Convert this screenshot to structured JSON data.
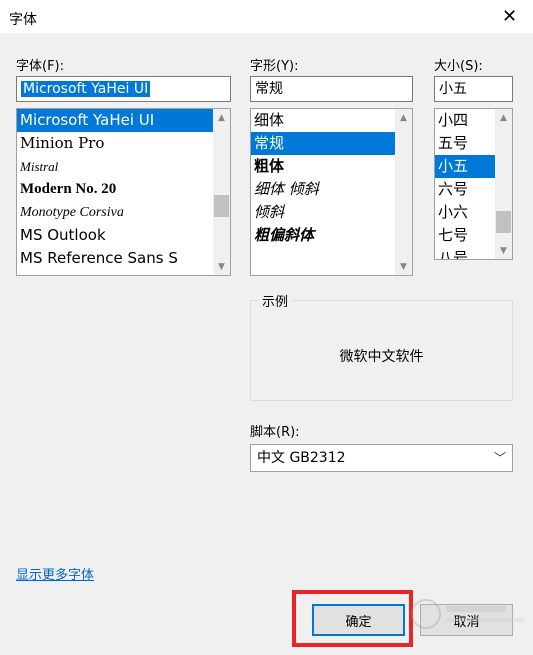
{
  "window": {
    "title": "字体",
    "close_glyph": "✕"
  },
  "font": {
    "label": "字体(F):",
    "value": "Microsoft YaHei UI",
    "items": [
      {
        "label": "Microsoft YaHei UI",
        "selected": true,
        "style": "sans"
      },
      {
        "label": "Minion Pro",
        "selected": false,
        "style": "serif"
      },
      {
        "label": "Mistral",
        "selected": false,
        "style": "script"
      },
      {
        "label": "Modern No. 20",
        "selected": false,
        "style": "bold-serif"
      },
      {
        "label": "Monotype Corsiva",
        "selected": false,
        "style": "italic-serif"
      },
      {
        "label": "MS Outlook",
        "selected": false,
        "style": "sans"
      },
      {
        "label": "MS Reference Sans S",
        "selected": false,
        "style": "sans"
      }
    ]
  },
  "style": {
    "label": "字形(Y):",
    "value": "常规",
    "items": [
      {
        "label": "细体",
        "selected": false,
        "style": "normal"
      },
      {
        "label": "常规",
        "selected": true,
        "style": "normal"
      },
      {
        "label": "粗体",
        "selected": false,
        "style": "bold"
      },
      {
        "label": "细体 倾斜",
        "selected": false,
        "style": "italic"
      },
      {
        "label": "倾斜",
        "selected": false,
        "style": "italic"
      },
      {
        "label": "粗偏斜体",
        "selected": false,
        "style": "bold-italic"
      }
    ]
  },
  "size": {
    "label": "大小(S):",
    "value": "小五",
    "items": [
      {
        "label": "小四",
        "selected": false
      },
      {
        "label": "五号",
        "selected": false
      },
      {
        "label": "小五",
        "selected": true
      },
      {
        "label": "六号",
        "selected": false
      },
      {
        "label": "小六",
        "selected": false
      },
      {
        "label": "七号",
        "selected": false
      },
      {
        "label": "八号",
        "selected": false
      }
    ]
  },
  "sample": {
    "title": "示例",
    "text": "微软中文软件"
  },
  "script": {
    "label": "脚本(R):",
    "value": "中文 GB2312"
  },
  "more_fonts_link": "显示更多字体",
  "buttons": {
    "ok": "确定",
    "cancel": "取消"
  },
  "colors": {
    "selection": "#0078d7",
    "highlight_box": "#e8262a",
    "link": "#0066cc"
  }
}
